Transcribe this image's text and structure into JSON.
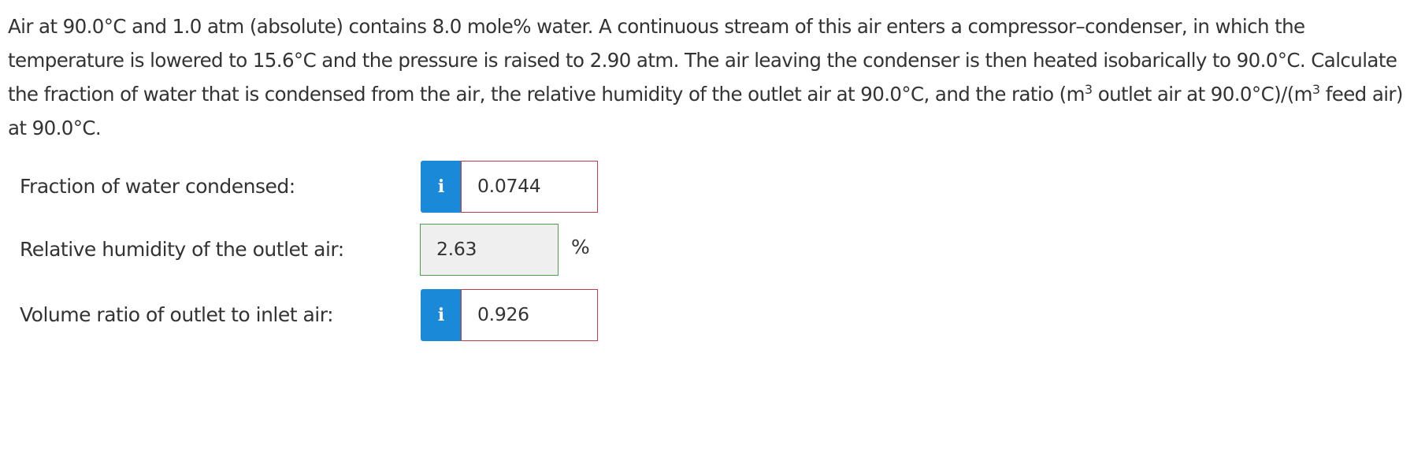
{
  "question": {
    "part1": "Air at 90.0°C and 1.0 atm (absolute) contains 8.0 mole% water. A continuous stream of this air enters a compressor–condenser, in which the temperature is lowered to 15.6°C and the pressure is raised to 2.90 atm. The air leaving the condenser is then heated isobarically to 90.0°C. Calculate the fraction of water that is condensed from the air, the relative humidity of the outlet air at 90.0°C, and the ratio (m",
    "sup1": "3",
    "part2": " outlet air at 90.0°C)/(m",
    "sup2": "3",
    "part3": " feed air) at 90.0°C."
  },
  "answers": [
    {
      "label": "Fraction of water condensed:",
      "value": "0.0744",
      "status": "incorrect",
      "has_info": true,
      "unit": ""
    },
    {
      "label": "Relative humidity of the outlet air:",
      "value": "2.63",
      "status": "correct",
      "has_info": false,
      "unit": "%"
    },
    {
      "label": "Volume ratio of outlet to inlet air:",
      "value": "0.926",
      "status": "incorrect",
      "has_info": true,
      "unit": ""
    }
  ],
  "icons": {
    "info": "i"
  },
  "colors": {
    "info_button": "#1a8ad8",
    "incorrect_border": "#c1394a",
    "correct_border": "#4f9d4f",
    "correct_background": "#efefef",
    "text": "#333333"
  }
}
